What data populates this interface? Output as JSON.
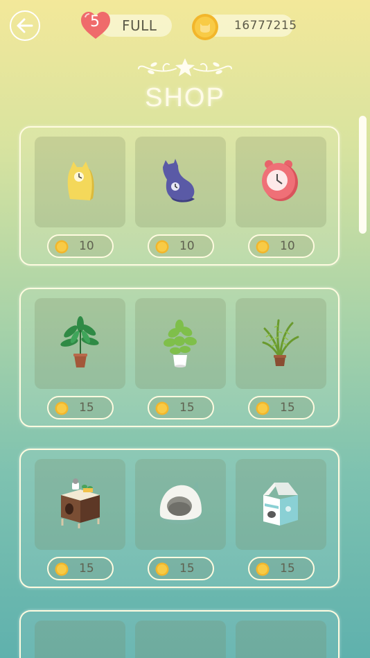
{
  "header": {
    "lives_count": "5",
    "lives_status": "FULL",
    "coin_balance": "16777215"
  },
  "title": "SHOP",
  "shelves": [
    {
      "items": [
        {
          "icon": "yellow-cat-clock-icon",
          "price": "10"
        },
        {
          "icon": "blue-cat-clock-icon",
          "price": "10"
        },
        {
          "icon": "red-alarm-clock-icon",
          "price": "10"
        }
      ]
    },
    {
      "items": [
        {
          "icon": "potted-palm-plant-icon",
          "price": "15"
        },
        {
          "icon": "white-pot-plant-icon",
          "price": "15"
        },
        {
          "icon": "fern-plant-icon",
          "price": "15"
        }
      ]
    },
    {
      "items": [
        {
          "icon": "cat-cabinet-icon",
          "price": "15"
        },
        {
          "icon": "cat-bed-pod-icon",
          "price": "15"
        },
        {
          "icon": "milk-carton-house-icon",
          "price": "15"
        }
      ]
    },
    {
      "items": [
        {
          "icon": "item-icon",
          "price": ""
        },
        {
          "icon": "item-icon",
          "price": ""
        },
        {
          "icon": "item-icon",
          "price": ""
        }
      ]
    }
  ],
  "colors": {
    "coin": "#f6c544",
    "heart": "#ef6b6b",
    "panel_border": "#fffbe0"
  }
}
